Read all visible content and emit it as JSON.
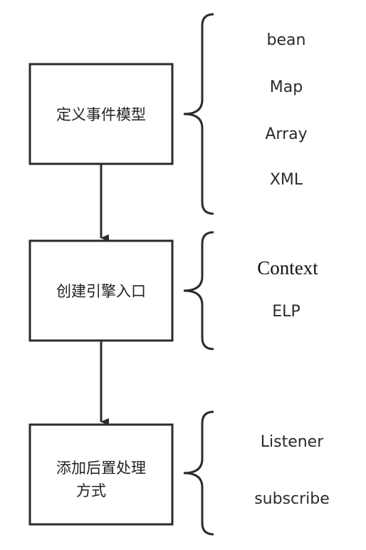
{
  "steps": [
    {
      "label_lines": [
        "定义事件模型"
      ],
      "options": [
        "bean",
        "Map",
        "Array",
        "XML"
      ]
    },
    {
      "label_lines": [
        "创建引擎入口"
      ],
      "options": [
        "Context",
        "ELP"
      ]
    },
    {
      "label_lines": [
        "添加后置处理",
        "方式"
      ],
      "options": [
        "Listener",
        "subscribe"
      ]
    }
  ],
  "colors": {
    "stroke": "#2b2b2b",
    "text": "#222222"
  }
}
